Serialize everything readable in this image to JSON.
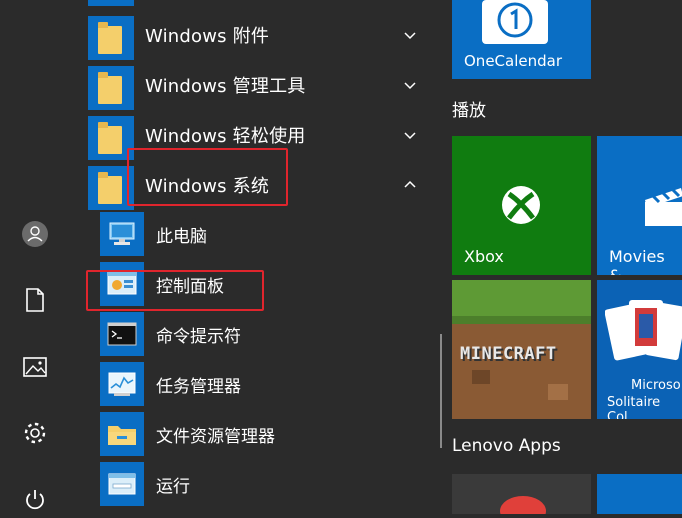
{
  "rail": {
    "items": [
      {
        "name": "user-avatar",
        "icon": "user-icon"
      },
      {
        "name": "documents",
        "icon": "document-icon"
      },
      {
        "name": "pictures",
        "icon": "picture-icon"
      },
      {
        "name": "settings",
        "icon": "gear-icon"
      },
      {
        "name": "power",
        "icon": "power-icon"
      }
    ]
  },
  "applist": {
    "folders": [
      {
        "label": "Windows 附件",
        "expanded": false
      },
      {
        "label": "Windows 管理工具",
        "expanded": false
      },
      {
        "label": "Windows 轻松使用",
        "expanded": false
      },
      {
        "label": "Windows 系统",
        "expanded": true
      }
    ],
    "system_items": [
      {
        "label": "此电脑",
        "icon": "computer-icon"
      },
      {
        "label": "控制面板",
        "icon": "control-panel-icon"
      },
      {
        "label": "命令提示符",
        "icon": "terminal-icon"
      },
      {
        "label": "任务管理器",
        "icon": "task-manager-icon"
      },
      {
        "label": "文件资源管理器",
        "icon": "folder-icon"
      },
      {
        "label": "运行",
        "icon": "run-icon"
      }
    ]
  },
  "tiles": {
    "onecalendar": {
      "label": "OneCalendar",
      "color": "#0a6ec4"
    },
    "group_play": {
      "title": "播放"
    },
    "xbox": {
      "label": "Xbox",
      "color": "#107c10"
    },
    "movies": {
      "label": "Movies &",
      "color": "#0a6ec4"
    },
    "minecraft": {
      "label": "MINECRAFT"
    },
    "solitaire": {
      "label_line1": "Microso",
      "label_line2": "Solitaire Col",
      "color": "#0b62b5"
    },
    "group_lenovo": {
      "title": "Lenovo Apps"
    }
  },
  "colors": {
    "accent": "#0a6ec4",
    "highlight_box": "#e0252d",
    "background": "#2b2b2b"
  }
}
